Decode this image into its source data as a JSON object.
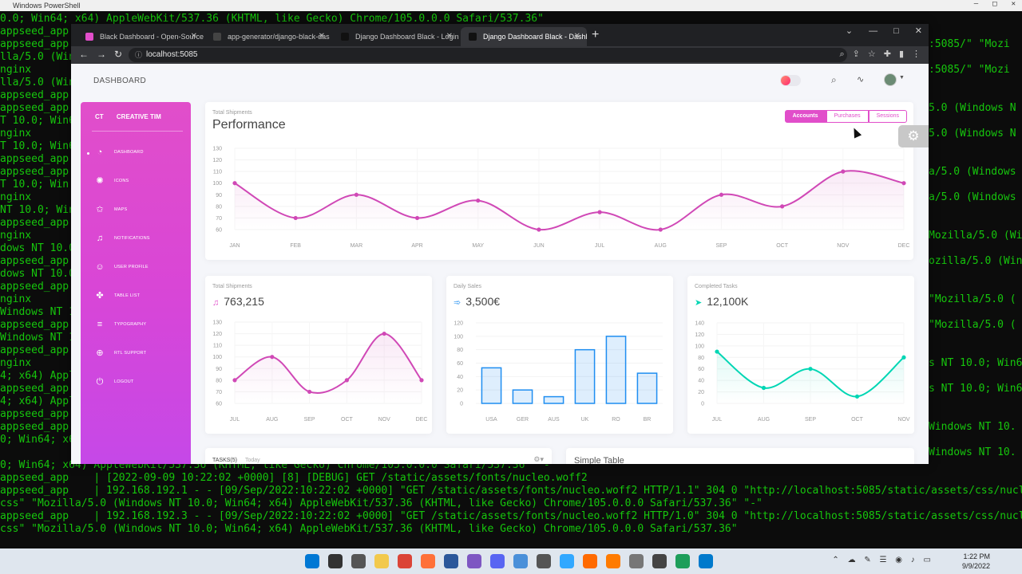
{
  "powershell": {
    "title": "Windows PowerShell",
    "lines": [
      {
        "y": 0,
        "text": "0.0; Win64; x64) AppleWebKit/537.36 (KHTML, like Gecko) Chrome/105.0.0.0 Safari/537.36\""
      },
      {
        "y": 16,
        "text": "appseed_app"
      },
      {
        "y": 32,
        "text": "appseed_app"
      },
      {
        "y": 48,
        "text": "lla/5.0 (Win"
      },
      {
        "y": 64,
        "text": "nginx"
      },
      {
        "y": 80,
        "text": "lla/5.0 (Win"
      },
      {
        "y": 96,
        "text": "appseed_app"
      },
      {
        "y": 112,
        "text": "appseed_app"
      },
      {
        "y": 128,
        "text": "T 10.0; Win6"
      },
      {
        "y": 144,
        "text": "nginx"
      },
      {
        "y": 160,
        "text": "T 10.0; Win6"
      },
      {
        "y": 176,
        "text": "appseed_app"
      },
      {
        "y": 192,
        "text": "appseed_app"
      },
      {
        "y": 208,
        "text": "T 10.0; Win"
      },
      {
        "y": 224,
        "text": "nginx"
      },
      {
        "y": 240,
        "text": "NT 10.0; Win"
      },
      {
        "y": 256,
        "text": "appseed_app"
      },
      {
        "y": 272,
        "text": "nginx"
      },
      {
        "y": 288,
        "text": "dows NT 10.0"
      },
      {
        "y": 304,
        "text": "appseed_app"
      },
      {
        "y": 320,
        "text": "dows NT 10.0"
      },
      {
        "y": 336,
        "text": "appseed_app"
      },
      {
        "y": 352,
        "text": "nginx"
      },
      {
        "y": 368,
        "text": "Windows NT 1"
      },
      {
        "y": 384,
        "text": "appseed_app"
      },
      {
        "y": 400,
        "text": "Windows NT 1"
      },
      {
        "y": 416,
        "text": "appseed_app"
      },
      {
        "y": 432,
        "text": "nginx"
      },
      {
        "y": 448,
        "text": "4; x64) Appl"
      },
      {
        "y": 464,
        "text": "appseed_app"
      },
      {
        "y": 480,
        "text": "4; x64) Appl"
      },
      {
        "y": 496,
        "text": "appseed_app"
      },
      {
        "y": 512,
        "text": "appseed_app"
      },
      {
        "y": 528,
        "text": "0; Win64; x6"
      },
      {
        "y": 560,
        "text": "0; Win64; x64) AppleWebKit/537.36 (KHTML, like Gecko) Chrome/105.0.0.0 Safari/537.36\" \"-\""
      },
      {
        "y": 576,
        "text": "appseed_app    | [2022-09-09 10:22:02 +0000] [8] [DEBUG] GET /static/assets/fonts/nucleo.woff2"
      },
      {
        "y": 592,
        "text": "appseed_app    | 192.168.192.1 - - [09/Sep/2022:10:22:02 +0000] \"GET /static/assets/fonts/nucleo.woff2 HTTP/1.1\" 304 0 \"http://localhost:5085/static/assets/css/nucleo-icons."
      },
      {
        "y": 608,
        "text": "css\" \"Mozilla/5.0 (Windows NT 10.0; Win64; x64) AppleWebKit/537.36 (KHTML, like Gecko) Chrome/105.0.0.0 Safari/537.36\" \"-\""
      },
      {
        "y": 624,
        "text": "appseed_app    | 192.168.192.3 - - [09/Sep/2022:10:22:02 +0000] \"GET /static/assets/fonts/nucleo.woff2 HTTP/1.0\" 304 0 \"http://localhost:5085/static/assets/css/nucleo-icons."
      },
      {
        "y": 640,
        "text": "css\" \"Mozilla/5.0 (Windows NT 10.0; Win64; x64) AppleWebKit/537.36 (KHTML, like Gecko) Chrome/105.0.0.0 Safari/537.36\""
      }
    ],
    "right_lines": [
      {
        "y": 32,
        "text": ":5085/\" \"Mozi"
      },
      {
        "y": 64,
        "text": ":5085/\" \"Mozi"
      },
      {
        "y": 112,
        "text": "5.0 (Windows N"
      },
      {
        "y": 144,
        "text": "5.0 (Windows N"
      },
      {
        "y": 192,
        "text": "a/5.0 (Windows"
      },
      {
        "y": 224,
        "text": "a/5.0 (Windows"
      },
      {
        "y": 272,
        "text": "Mozilla/5.0 (Win"
      },
      {
        "y": 304,
        "text": "ozilla/5.0 (Win"
      },
      {
        "y": 352,
        "text": "\"Mozilla/5.0 ("
      },
      {
        "y": 384,
        "text": "\"Mozilla/5.0 ("
      },
      {
        "y": 432,
        "text": "s NT 10.0; Win6"
      },
      {
        "y": 464,
        "text": "s NT 10.0; Win6"
      },
      {
        "y": 512,
        "text": "Windows NT 10."
      },
      {
        "y": 544,
        "text": "Windows NT 10."
      }
    ]
  },
  "browser": {
    "tabs": [
      {
        "label": "Black Dashboard - Open-Source",
        "fav": "#e14eca",
        "active": false
      },
      {
        "label": "app-generator/django-black-das",
        "fav": "#444",
        "active": false
      },
      {
        "label": "Django Dashboard Black - Login",
        "fav": "#111",
        "active": false
      },
      {
        "label": "Django Dashboard Black - Dashb",
        "fav": "#111",
        "active": true
      }
    ],
    "url": "localhost:5085"
  },
  "header": {
    "title": "DASHBOARD"
  },
  "sidebar": {
    "brand_short": "CT",
    "brand": "CREATIVE TIM",
    "items": [
      {
        "label": "DASHBOARD",
        "icon": "pie-chart-icon",
        "glyph": "◔"
      },
      {
        "label": "ICONS",
        "icon": "atom-icon",
        "glyph": "✺"
      },
      {
        "label": "MAPS",
        "icon": "pin-icon",
        "glyph": "✩"
      },
      {
        "label": "NOTIFICATIONS",
        "icon": "bell-icon",
        "glyph": "♫"
      },
      {
        "label": "USER PROFILE",
        "icon": "user-icon",
        "glyph": "☺"
      },
      {
        "label": "TABLE LIST",
        "icon": "puzzle-icon",
        "glyph": "✤"
      },
      {
        "label": "TYPOGRAPHY",
        "icon": "align-icon",
        "glyph": "≡"
      },
      {
        "label": "RTL SUPPORT",
        "icon": "world-icon",
        "glyph": "⊕"
      },
      {
        "label": "LOGOUT",
        "icon": "power-icon",
        "glyph": "⏻"
      }
    ]
  },
  "performance": {
    "category": "Total Shipments",
    "title": "Performance",
    "buttons": [
      "Accounts",
      "Purchases",
      "Sessions"
    ],
    "active_button": "Accounts"
  },
  "shipments": {
    "category": "Total Shipments",
    "value": "763,215",
    "icon": "bell-icon"
  },
  "sales": {
    "category": "Daily Sales",
    "value": "3,500€",
    "icon": "delivery-icon"
  },
  "tasks_done": {
    "category": "Completed Tasks",
    "value": "12,100K",
    "icon": "send-icon"
  },
  "tasks": {
    "tab": "TASKS(5)",
    "today": "Today"
  },
  "simple_table": {
    "title": "Simple Table"
  },
  "taskbar": {
    "time": "1:22 PM",
    "date": "9/9/2022"
  },
  "colors": {
    "accent": "#e14eca",
    "line_pink": "#d048b6",
    "bar_blue": "#1f8ef1",
    "line_teal": "#00d6b4"
  },
  "chart_data": [
    {
      "type": "line",
      "categories": [
        "JAN",
        "FEB",
        "MAR",
        "APR",
        "MAY",
        "JUN",
        "JUL",
        "AUG",
        "SEP",
        "OCT",
        "NOV",
        "DEC"
      ],
      "series": [
        {
          "values": [
            100,
            70,
            90,
            70,
            85,
            60,
            75,
            60,
            90,
            80,
            110,
            100
          ]
        }
      ],
      "yticks": [
        60,
        70,
        80,
        90,
        100,
        110,
        120,
        130
      ],
      "ylim": [
        60,
        130
      ]
    },
    {
      "type": "line",
      "categories": [
        "JUL",
        "AUG",
        "SEP",
        "OCT",
        "NOV",
        "DEC"
      ],
      "series": [
        {
          "values": [
            80,
            100,
            70,
            80,
            120,
            80
          ]
        }
      ],
      "yticks": [
        60,
        70,
        80,
        90,
        100,
        110,
        120,
        130
      ],
      "ylim": [
        60,
        130
      ]
    },
    {
      "type": "bar",
      "categories": [
        "USA",
        "GER",
        "AUS",
        "UK",
        "RO",
        "BR"
      ],
      "values": [
        53,
        20,
        10,
        80,
        100,
        45
      ],
      "yticks": [
        0,
        20,
        40,
        60,
        80,
        100,
        120
      ],
      "ylim": [
        0,
        120
      ]
    },
    {
      "type": "line",
      "categories": [
        "JUL",
        "AUG",
        "SEP",
        "OCT",
        "NOV"
      ],
      "series": [
        {
          "values": [
            90,
            27,
            60,
            12,
            80
          ]
        }
      ],
      "yticks": [
        0,
        20,
        40,
        60,
        80,
        100,
        120,
        140
      ],
      "ylim": [
        0,
        140
      ]
    }
  ]
}
